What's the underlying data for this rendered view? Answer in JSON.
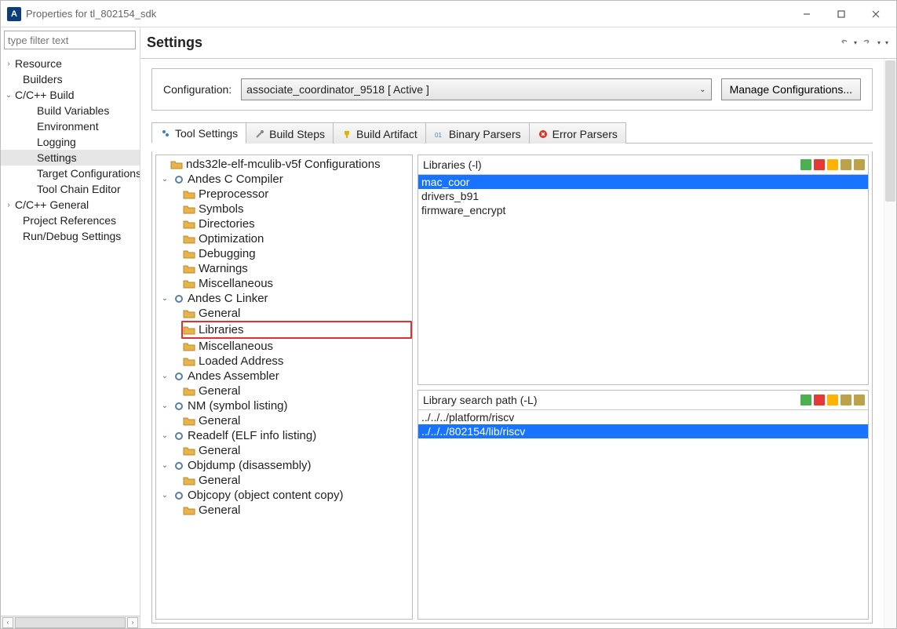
{
  "window": {
    "title": "Properties for tl_802154_sdk"
  },
  "sidebar": {
    "filter_placeholder": "type filter text",
    "items": {
      "resource": "Resource",
      "builders": "Builders",
      "cbuild": "C/C++ Build",
      "build_vars": "Build Variables",
      "environment": "Environment",
      "logging": "Logging",
      "settings": "Settings",
      "target_conf": "Target Configurations",
      "toolchain": "Tool Chain Editor",
      "cgeneral": "C/C++ General",
      "proj_refs": "Project References",
      "rundebug": "Run/Debug Settings"
    }
  },
  "page": {
    "title": "Settings",
    "config_label": "Configuration:",
    "config_value": "associate_coordinator_9518  [ Active ]",
    "manage_btn": "Manage Configurations..."
  },
  "tabs": {
    "tool_settings": "Tool Settings",
    "build_steps": "Build Steps",
    "build_artifact": "Build Artifact",
    "binary_parsers": "Binary Parsers",
    "error_parsers": "Error Parsers"
  },
  "tool_tree": {
    "nds_config": "nds32le-elf-mculib-v5f Configurations",
    "andes_c_compiler": "Andes C Compiler",
    "preprocessor": "Preprocessor",
    "symbols": "Symbols",
    "directories": "Directories",
    "optimization": "Optimization",
    "debugging": "Debugging",
    "warnings": "Warnings",
    "miscellaneous": "Miscellaneous",
    "andes_c_linker": "Andes C Linker",
    "general": "General",
    "libraries": "Libraries",
    "loaded_address": "Loaded Address",
    "andes_assembler": "Andes Assembler",
    "nm": "NM (symbol listing)",
    "readelf": "Readelf (ELF info listing)",
    "objdump": "Objdump (disassembly)",
    "objcopy": "Objcopy (object content copy)"
  },
  "libs_panel": {
    "title": "Libraries (-l)",
    "rows": [
      "mac_coor",
      "drivers_b91",
      "firmware_encrypt"
    ]
  },
  "libpath_panel": {
    "title": "Library search path (-L)",
    "rows": [
      "../../../platform/riscv",
      "../../../802154/lib/riscv"
    ]
  }
}
